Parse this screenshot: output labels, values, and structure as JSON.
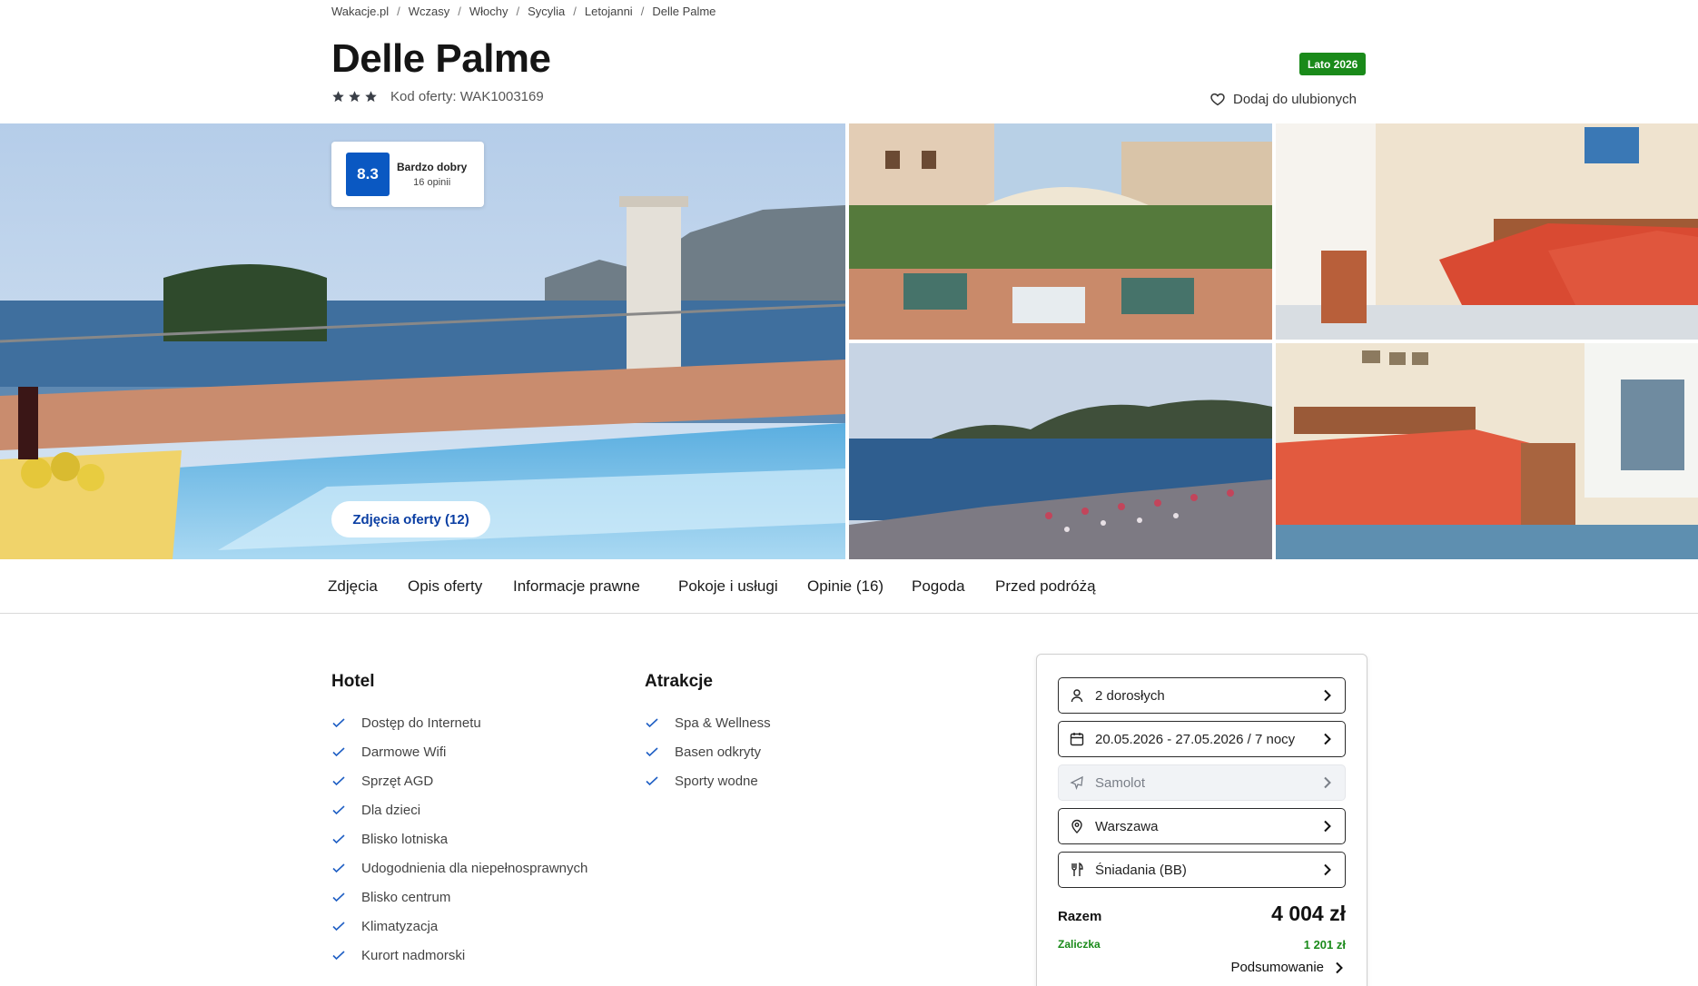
{
  "breadcrumb": [
    "Wakacje.pl",
    "Wczasy",
    "Włochy",
    "Sycylia",
    "Letojanni",
    "Delle Palme"
  ],
  "hotel": {
    "name": "Delle Palme",
    "stars": 3,
    "offer_code": "Kod oferty: WAK1003169",
    "season_badge": "Lato 2026",
    "favorite_label": "Dodaj do ulubionych"
  },
  "rating": {
    "score": "8.3",
    "label": "Bardzo dobry",
    "count": "16 opinii"
  },
  "gallery": {
    "photos_button": "Zdjęcia oferty (12)",
    "photos": [
      "rooftop-pool",
      "garden-terrace",
      "twin-room",
      "sea-beach",
      "double-room"
    ]
  },
  "tabs": [
    "Zdjęcia",
    "Opis oferty",
    "Informacje prawne",
    "Pokoje i usługi",
    "Opinie (16)",
    "Pogoda",
    "Przed podróżą"
  ],
  "amenities": {
    "hotel": {
      "title": "Hotel",
      "items": [
        "Dostęp do Internetu",
        "Darmowe Wifi",
        "Sprzęt AGD",
        "Dla dzieci",
        "Blisko lotniska",
        "Udogodnienia dla niepełnosprawnych",
        "Blisko centrum",
        "Klimatyzacja",
        "Kurort nadmorski"
      ]
    },
    "attractions": {
      "title": "Atrakcje",
      "items": [
        "Spa & Wellness",
        "Basen odkryty",
        "Sporty wodne"
      ]
    }
  },
  "booking": {
    "travelers": "2 dorosłych",
    "dates": "20.05.2026 - 27.05.2026 / 7 nocy",
    "transport": "Samolot",
    "departure": "Warszawa",
    "board": "Śniadania (BB)",
    "total_label": "Razem",
    "total_value": "4 004 zł",
    "deposit_label": "Zaliczka",
    "deposit_value": "1 201 zł",
    "summary_label": "Podsumowanie"
  },
  "colors": {
    "accent_blue": "#0a58c2",
    "link_blue": "#0a3ea3",
    "badge_green": "#1a8a1a",
    "check_blue": "#1f5fc4"
  }
}
